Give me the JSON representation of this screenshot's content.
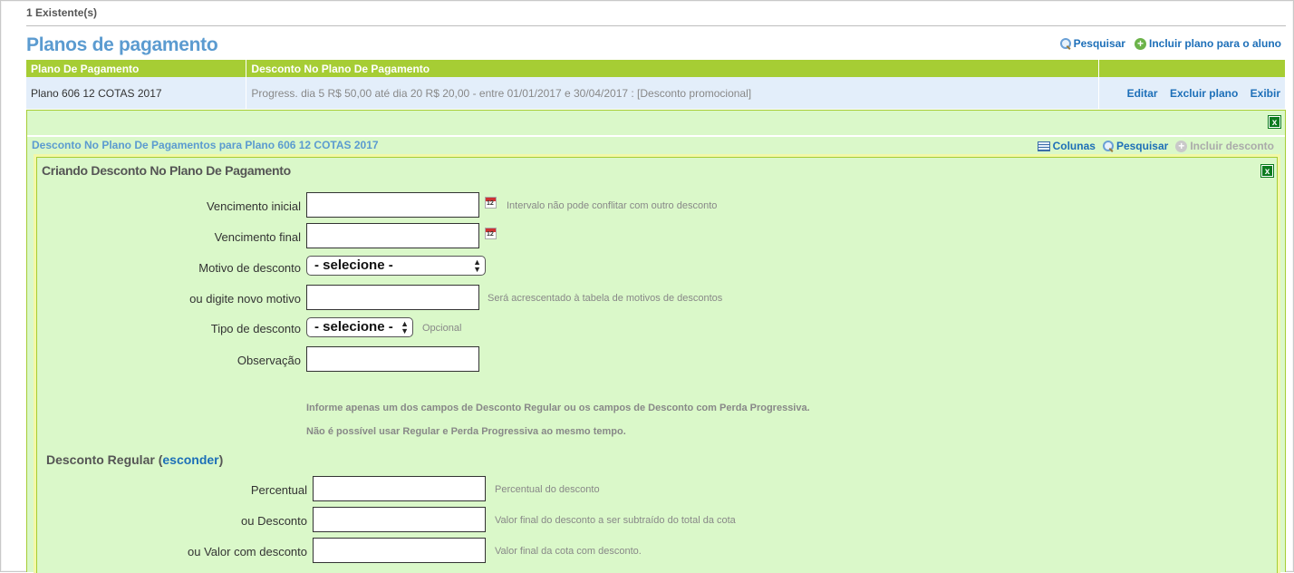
{
  "existing_count": "1 Existente(s)",
  "page": {
    "title": "Planos de pagamento",
    "search_label": "Pesquisar",
    "add_plan_label": "Incluir plano para o aluno"
  },
  "table": {
    "headers": [
      "Plano De Pagamento",
      "Desconto No Plano De Pagamento",
      ""
    ],
    "rows": [
      {
        "plan": "Plano 606 12 COTAS 2017",
        "discount": "Progress. dia 5 R$ 50,00 até dia 20 R$ 20,00 - entre 01/01/2017 e 30/04/2017 : [Desconto promocional]",
        "actions": [
          "Editar",
          "Excluir plano",
          "Exibir"
        ]
      }
    ]
  },
  "discount_panel": {
    "close_label": "x",
    "title": "Desconto No Plano De Pagamentos para Plano 606 12 COTAS 2017",
    "tools": {
      "columns_label": "Colunas",
      "search_label": "Pesquisar",
      "add_label": "Incluir desconto"
    }
  },
  "form": {
    "title": "Criando Desconto No Plano De Pagamento",
    "close_label": "x",
    "calendar_day": "12",
    "fields": {
      "venc_inicial": {
        "label": "Vencimento inicial",
        "value": "",
        "hint": "Intervalo não pode conflitar com outro desconto"
      },
      "venc_final": {
        "label": "Vencimento final",
        "value": ""
      },
      "motivo": {
        "label": "Motivo de desconto",
        "selected": "- selecione -"
      },
      "novo_motivo": {
        "label": "ou digite novo motivo",
        "value": "",
        "hint": "Será acrescentado à tabela de motivos de descontos"
      },
      "tipo": {
        "label": "Tipo de desconto",
        "selected": "- selecione -",
        "hint": "Opcional"
      },
      "observacao": {
        "label": "Observação",
        "value": ""
      }
    },
    "notice_1": "Informe apenas um dos campos de Desconto Regular ou os campos de Desconto com Perda Progressiva.",
    "notice_2": "Não é possível usar Regular e Perda Progressiva ao mesmo tempo.",
    "regular": {
      "title": "Desconto Regular",
      "open_paren": "(",
      "toggle_label": "esconder",
      "close_paren": ")",
      "percentual": {
        "label": "Percentual",
        "value": "",
        "hint": "Percentual do desconto"
      },
      "desconto": {
        "label": "ou Desconto",
        "value": "",
        "hint": "Valor final do desconto a ser subtraído do total da cota"
      },
      "valor": {
        "label": "ou Valor com desconto",
        "value": "",
        "hint": "Valor final da cota com desconto."
      }
    }
  }
}
